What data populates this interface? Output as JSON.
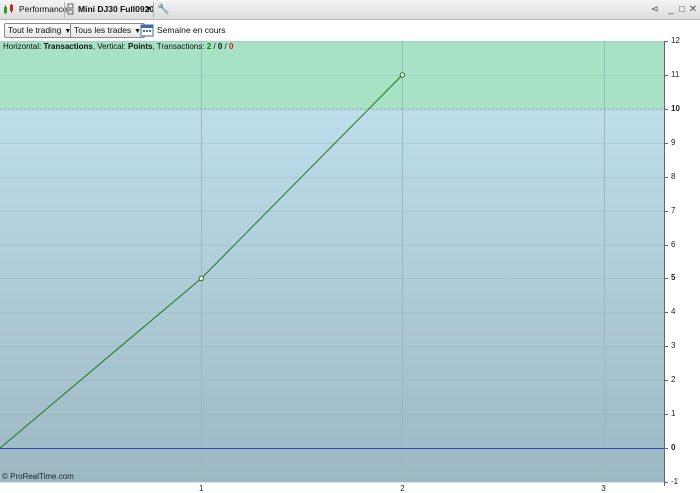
{
  "window": {
    "title": "Performance",
    "instrument": "Mini DJ30 Full0920",
    "menu_icon": "chevron-down-icon",
    "tool_icon": "wrench-icon",
    "share_icon": "share-icon",
    "minimize_icon": "minimize-icon",
    "maximize_icon": "maximize-icon",
    "close_icon": "close-icon"
  },
  "toolbar": {
    "filter1": "Tout le trading",
    "filter2": "Tous les trades",
    "period": "Semaine en cours"
  },
  "info": {
    "horizontal_label": "Horizontal:",
    "horizontal_value": "Transactions",
    "vertical_label": ", Vertical:",
    "vertical_value": "Points",
    "transactions_label": ", Transactions:",
    "winning": "2",
    "neutral": "0",
    "losing": "0",
    "sep": " / "
  },
  "copyright": "© ProRealTime.com",
  "colors": {
    "green_zone": "#a6e2c3",
    "blue_top": "#c4e4f2",
    "blue_bottom": "#9cb8c3",
    "equity_line": "#1a7a1a",
    "zero_line": "#3344cc",
    "win_text": "#1a7a1a",
    "loss_text": "#cc2222"
  },
  "chart_data": {
    "type": "line",
    "series": [
      {
        "x": [
          0,
          1,
          2
        ],
        "y": [
          0,
          5,
          11
        ]
      }
    ],
    "xlim": [
      0,
      3.3
    ],
    "ylim": [
      -1,
      12
    ],
    "xticks": [
      "1",
      "2",
      "3"
    ],
    "yticks": [
      "12",
      "11",
      "10",
      "9",
      "8",
      "7",
      "6",
      "5",
      "4",
      "3",
      "2",
      "1",
      "0",
      "-1"
    ],
    "highlight_min": 10,
    "grid": true
  }
}
